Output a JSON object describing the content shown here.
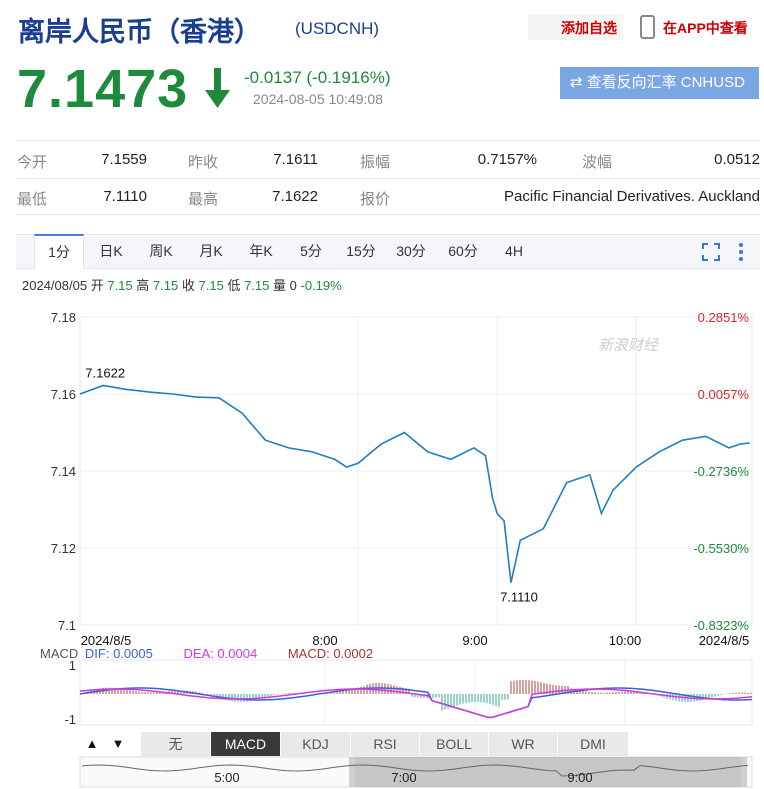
{
  "header": {
    "title": "离岸人民币（香港）",
    "code": "(USDCNH)",
    "add_favorite": "添加自选",
    "view_in_app": "在APP中查看"
  },
  "quote": {
    "price": "7.1473",
    "change": "-0.0137 (-0.1916%)",
    "timestamp": "2024-08-05 10:49:08",
    "reverse_button": "查看反向汇率 CNHUSD"
  },
  "stats": [
    {
      "label": "今开",
      "value": "7.1559"
    },
    {
      "label": "昨收",
      "value": "7.1611"
    },
    {
      "label": "振幅",
      "value": "0.7157%"
    },
    {
      "label": "波幅",
      "value": "0.0512"
    },
    {
      "label": "最低",
      "value": "7.1110"
    },
    {
      "label": "最高",
      "value": "7.1622"
    },
    {
      "label": "报价",
      "value": "Pacific Financial Derivatives. Auckland"
    }
  ],
  "period_tabs": [
    "1分",
    "日K",
    "周K",
    "月K",
    "年K",
    "5分",
    "15分",
    "30分",
    "60分",
    "4H"
  ],
  "active_tab": "1分",
  "ohlc_bar": {
    "date": "2024/08/05",
    "open_label": "开",
    "open": "7.15",
    "high_label": "高",
    "high": "7.15",
    "close_label": "收",
    "close": "7.15",
    "low_label": "低",
    "low": "7.15",
    "volume_label": "量",
    "volume": "0",
    "change": "-0.19%"
  },
  "macd_legend": {
    "name": "MACD",
    "dif": "DIF: 0.0005",
    "dea": "DEA: 0.0004",
    "macd": "MACD: 0.0002"
  },
  "indicator_tabs": [
    "无",
    "MACD",
    "KDJ",
    "RSI",
    "BOLL",
    "WR",
    "DMI"
  ],
  "active_indicator": "MACD",
  "navigator_labels": [
    "5:00",
    "7:00",
    "9:00"
  ],
  "watermark": "新浪财经",
  "colors": {
    "down": "#1e8a3c",
    "up": "#d62728",
    "line": "#1f7fc4",
    "brand": "#1a3f8e"
  },
  "chart_data": {
    "type": "line",
    "yticks": [
      "7.18",
      "7.16",
      "7.14",
      "7.12",
      "7.1"
    ],
    "ylim": [
      7.1,
      7.18
    ],
    "pct_ticks": [
      "0.2851%",
      "0.0057%",
      "-0.2736%",
      "-0.5530%",
      "-0.8323%"
    ],
    "xticks": [
      "2024/8/5",
      "8:00",
      "9:00",
      "10:00",
      "2024/8/5"
    ],
    "annotations": [
      {
        "text": "7.1622"
      },
      {
        "text": "7.1110"
      }
    ],
    "series": [
      {
        "x": [
          "06:00",
          "06:10",
          "06:20",
          "06:30",
          "06:40",
          "06:50",
          "07:00",
          "07:10",
          "07:20",
          "07:30",
          "07:40",
          "07:50",
          "07:55",
          "08:00",
          "08:10",
          "08:20",
          "08:30",
          "08:40",
          "08:50",
          "08:55",
          "08:58",
          "09:00",
          "09:03",
          "09:06",
          "09:10",
          "09:20",
          "09:30",
          "09:40",
          "09:45",
          "09:50",
          "10:00",
          "10:10",
          "10:20",
          "10:30",
          "10:40",
          "10:45",
          "10:49"
        ],
        "values": [
          7.16,
          7.1622,
          7.1612,
          7.1605,
          7.16,
          7.1592,
          7.159,
          7.155,
          7.148,
          7.146,
          7.145,
          7.143,
          7.141,
          7.142,
          7.147,
          7.15,
          7.145,
          7.143,
          7.146,
          7.144,
          7.133,
          7.129,
          7.127,
          7.111,
          7.122,
          7.125,
          7.137,
          7.139,
          7.129,
          7.135,
          7.141,
          7.145,
          7.148,
          7.149,
          7.146,
          7.147,
          7.1473
        ]
      }
    ]
  }
}
